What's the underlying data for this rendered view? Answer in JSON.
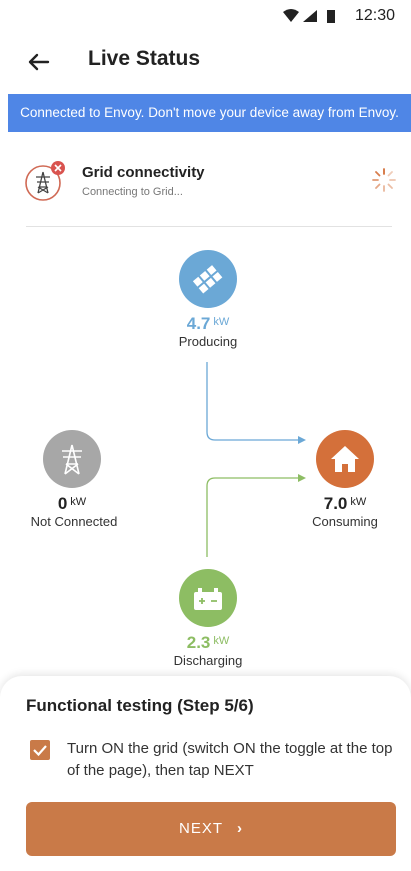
{
  "status_bar": {
    "time": "12:30"
  },
  "app_bar": {
    "title": "Live Status"
  },
  "banner": {
    "text": "Connected to Envoy. Don't move your device away from Envoy."
  },
  "grid_status": {
    "title": "Grid connectivity",
    "subtitle": "Connecting to Grid..."
  },
  "flow": {
    "producing": {
      "value": "4.7",
      "unit": "kW",
      "label": "Producing",
      "color": "#6ba8d6"
    },
    "grid": {
      "value": "0",
      "unit": "kW",
      "label": "Not Connected",
      "color": "#a7a7a7"
    },
    "consuming": {
      "value": "7.0",
      "unit": "kW",
      "label": "Consuming",
      "color": "#d4703a"
    },
    "battery": {
      "value": "2.3",
      "unit": "kW",
      "label": "Discharging",
      "color": "#8dbd63"
    }
  },
  "sheet": {
    "title": "Functional testing (Step 5/6)",
    "checkbox_text": "Turn ON the grid (switch ON the toggle at the top of the page), then tap NEXT",
    "checked": true,
    "next_label": "NEXT"
  }
}
